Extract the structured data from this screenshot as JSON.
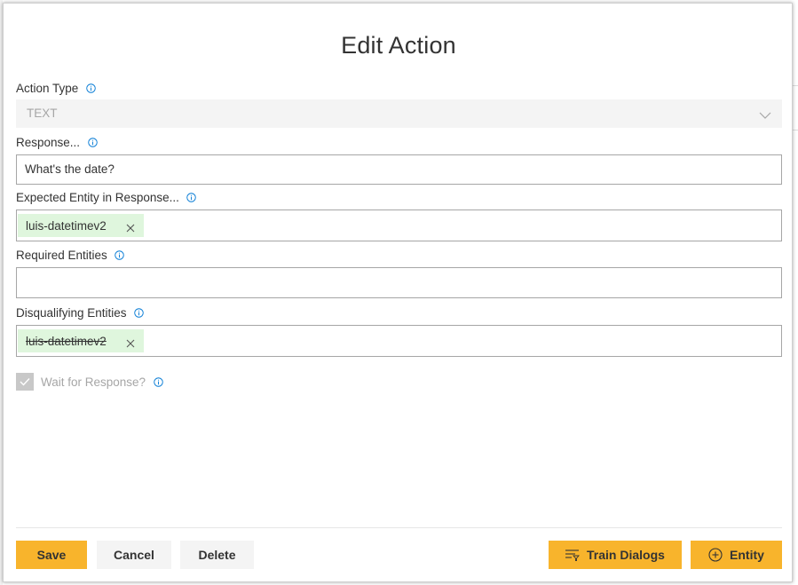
{
  "modal": {
    "title": "Edit Action"
  },
  "fields": {
    "action_type": {
      "label": "Action Type",
      "value": "TEXT"
    },
    "response": {
      "label": "Response...",
      "value": "What's the date?"
    },
    "expected_entity": {
      "label": "Expected Entity in Response...",
      "tags": [
        "luis-datetimev2"
      ]
    },
    "required_entities": {
      "label": "Required Entities",
      "value": ""
    },
    "disqualifying_entities": {
      "label": "Disqualifying Entities",
      "tags": [
        "luis-datetimev2"
      ]
    },
    "wait_for_response": {
      "label": "Wait for Response?",
      "checked": true,
      "disabled": true
    }
  },
  "buttons": {
    "save": "Save",
    "cancel": "Cancel",
    "delete": "Delete",
    "train_dialogs": "Train Dialogs",
    "entity": "Entity"
  },
  "icons": {
    "info": "info-icon",
    "chevron": "chevron-down-icon",
    "close": "close-icon",
    "check": "checkmark-icon",
    "filter": "filter-list-icon",
    "add": "add-circle-icon"
  },
  "colors": {
    "primary_button": "#f8b42c",
    "tag_background": "#dff6dd",
    "info_icon": "#0078d4"
  }
}
